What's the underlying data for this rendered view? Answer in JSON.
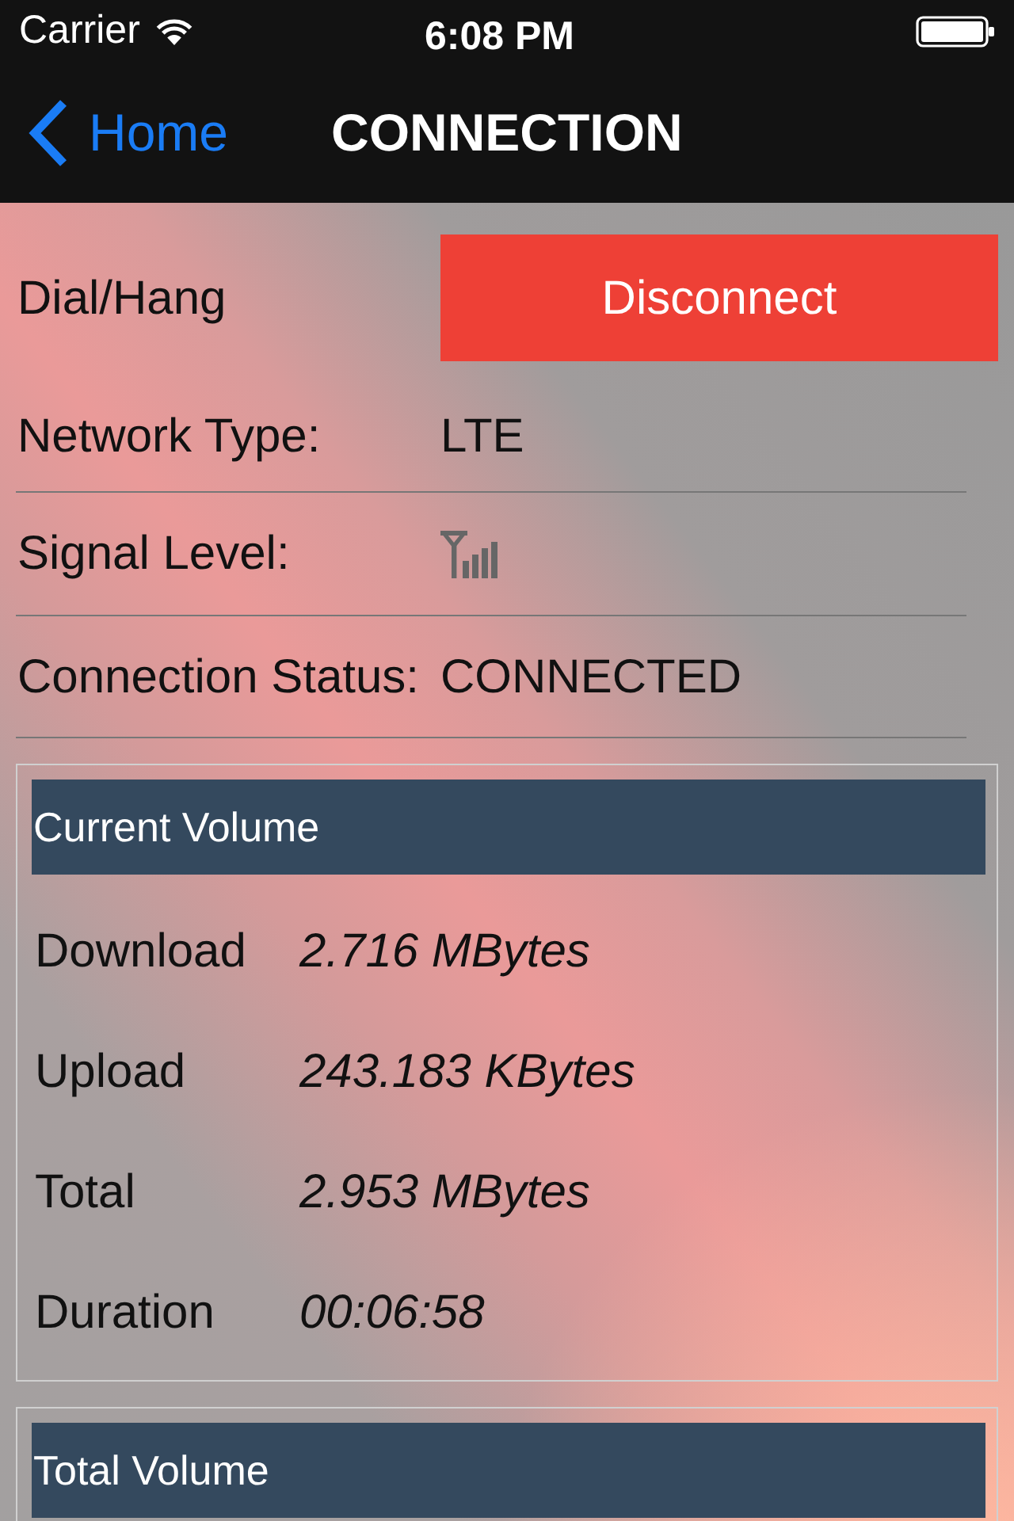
{
  "status_bar": {
    "carrier": "Carrier",
    "time": "6:08 PM"
  },
  "nav_bar": {
    "back": "Home",
    "title": "CONNECTION"
  },
  "dial": {
    "label": "Dial/Hang",
    "button": "Disconnect"
  },
  "info_rows": [
    {
      "kind": "text",
      "label": "Network Type:",
      "value": "LTE"
    },
    {
      "kind": "signal",
      "label": "Signal Level:"
    },
    {
      "kind": "text",
      "label": "Connection Status:",
      "value": "CONNECTED"
    }
  ],
  "panels": [
    {
      "title": "Current Volume",
      "rows": [
        {
          "label": "Download",
          "value": "2.716 MBytes"
        },
        {
          "label": "Upload",
          "value": "243.183 KBytes"
        },
        {
          "label": "Total",
          "value": "2.953 MBytes"
        },
        {
          "label": "Duration",
          "value": "00:06:58"
        }
      ]
    },
    {
      "title": "Total Volume"
    }
  ]
}
